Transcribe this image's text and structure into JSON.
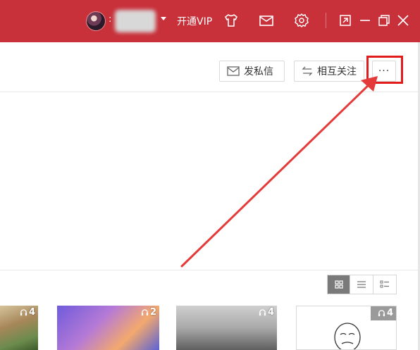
{
  "titlebar": {
    "username_visible": ":",
    "vip_label": "开通VIP",
    "icons": [
      "avatar",
      "dropdown-caret-icon",
      "shirt-icon",
      "mail-icon",
      "gear-icon",
      "restore-small-icon",
      "minimize-icon",
      "maximize-icon",
      "close-icon"
    ]
  },
  "actions": {
    "message_label": "发私信",
    "follow_label": "相互关注",
    "more_label": "···"
  },
  "view_toggle": {
    "options": [
      "grid-view",
      "list-view",
      "detail-list-view"
    ],
    "active": "grid-view"
  },
  "thumbnails": [
    {
      "count": "4"
    },
    {
      "count": "2"
    },
    {
      "count": "4"
    },
    {
      "count": "4"
    }
  ],
  "colors": {
    "titlebar": "#c8303a",
    "highlight": "#e21c1c",
    "arrow": "#e53a3a"
  }
}
